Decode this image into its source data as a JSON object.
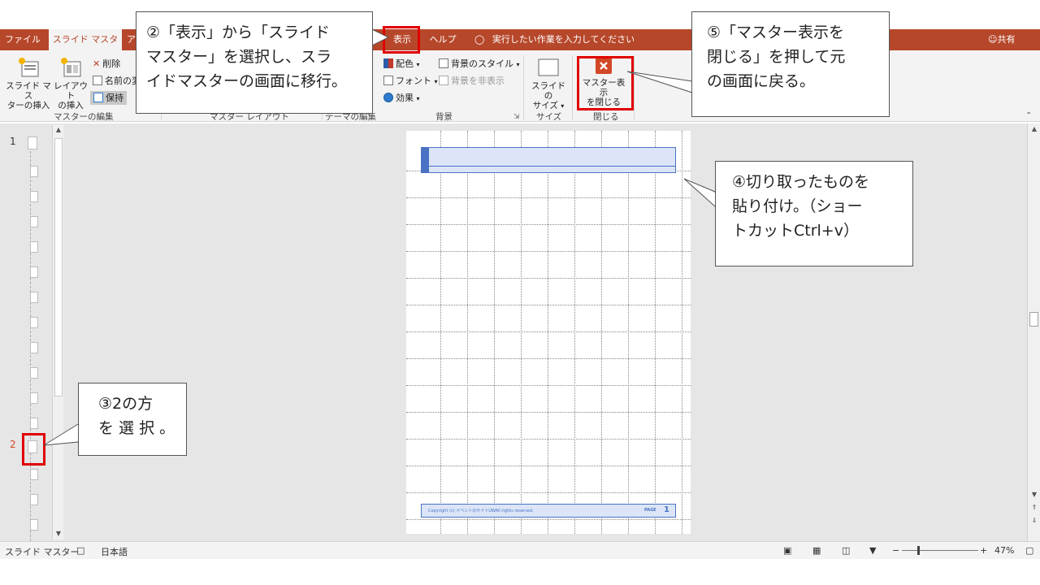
{
  "tabs": {
    "file": "ファイル",
    "slide_master": "スライド マスター",
    "clipped_tab": "ア",
    "view": "表示",
    "help": "ヘルプ",
    "tell_me": "実行したい作業を入力してください",
    "share": "共有"
  },
  "ribbon": {
    "insert_slide_master": [
      "スライド マス",
      "ターの挿入"
    ],
    "insert_layout": [
      "レイアウト",
      "の挿入"
    ],
    "delete": "削除",
    "rename": "名前の変",
    "preserve": "保持",
    "colors": "配色",
    "fonts": "フォント",
    "effects": "効果",
    "background_styles": "背景のスタイル",
    "hide_background": "背景を非表示",
    "slide_size": [
      "スライドの",
      "サイズ"
    ],
    "close_master": [
      "マスター表示",
      "を閉じる"
    ],
    "groups": {
      "edit_master": "マスターの編集",
      "master_layout": "マスター レイアウト",
      "edit_theme": "テーマの編集",
      "background": "背景",
      "size": "サイズ",
      "close": "閉じる"
    }
  },
  "thumbnails": {
    "num1": "1",
    "num2": "2"
  },
  "slide": {
    "footer_copyright": "Copyright (c) イベントのサイトUWAll rights reserved.",
    "footer_page_label": "PAGE",
    "footer_page_number": "1"
  },
  "status": {
    "view_mode": "スライド マスター",
    "language": "日本語",
    "zoom": "47%"
  },
  "callouts": {
    "step2": [
      "②「表示」から「スライド",
      "マスター」を選択し、スラ",
      "イドマスターの画面に移行。"
    ],
    "step3": [
      "③2の方",
      "を 選 択 。"
    ],
    "step4": [
      "④切り取ったものを",
      "貼り付け。（ショー",
      "トカットCtrl+v）"
    ],
    "step5": [
      "⑤「マスター表示を",
      "閉じる」を押して元",
      "の画面に戻る。"
    ]
  },
  "colors": {
    "ribbon_accent": "#b7472a",
    "highlight_red": "#e00000",
    "placeholder_blue": "#4a72c4"
  }
}
